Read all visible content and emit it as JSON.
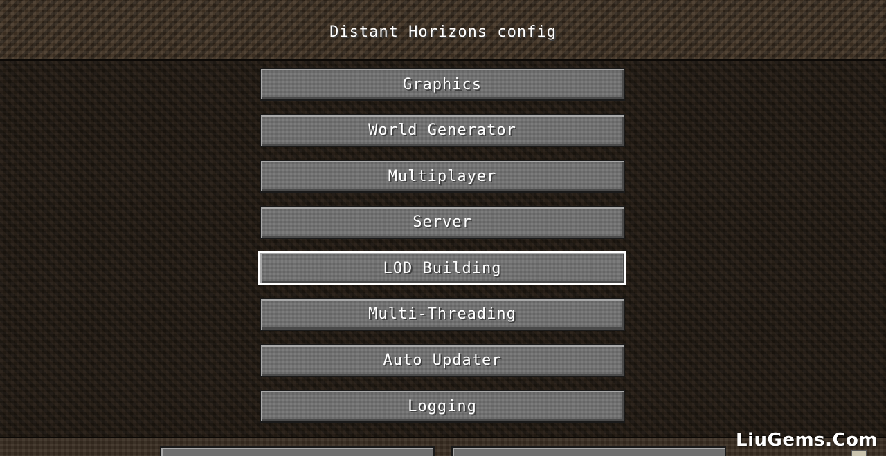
{
  "header": {
    "title": "Distant Horizons config"
  },
  "menu": {
    "items": [
      {
        "label": "Graphics"
      },
      {
        "label": "World Generator"
      },
      {
        "label": "Multiplayer"
      },
      {
        "label": "Server"
      },
      {
        "label": "LOD Building",
        "hovered": true
      },
      {
        "label": "Multi-Threading"
      },
      {
        "label": "Auto Updater"
      },
      {
        "label": "Logging"
      }
    ]
  },
  "watermark": {
    "text": "LiuGems.Com"
  },
  "colors": {
    "button_face": "#6f6f6f",
    "hover_border": "#ffffff",
    "background": "#1d1711",
    "text": "#ffffff"
  }
}
